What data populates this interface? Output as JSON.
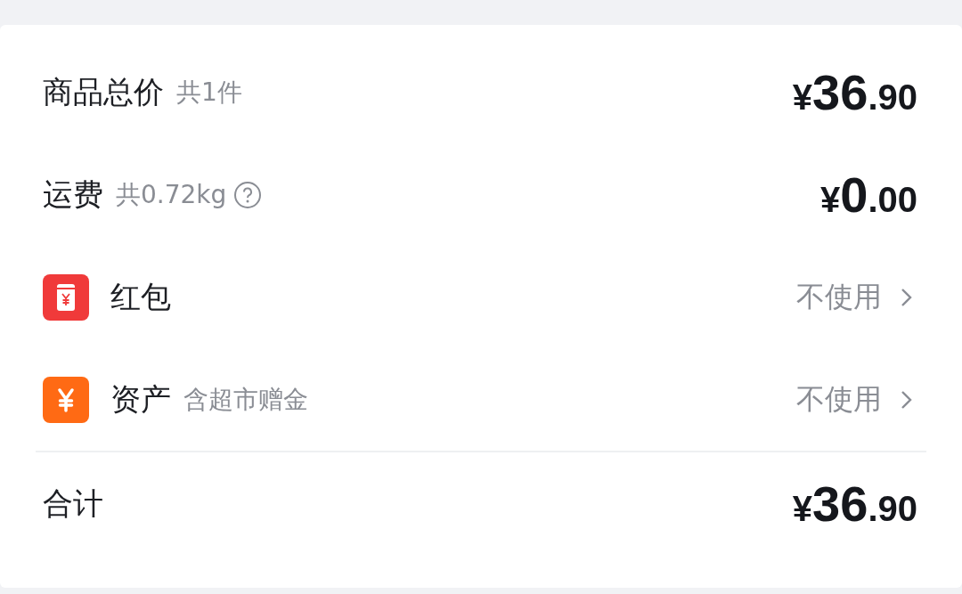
{
  "rows": [
    {
      "kind": "price",
      "label": "商品总价",
      "note": "共1件",
      "price": {
        "currency": "¥",
        "whole": "36",
        "decimal": ".90"
      }
    },
    {
      "kind": "price",
      "label": "运费",
      "note": "共0.72kg",
      "help": true,
      "price": {
        "currency": "¥",
        "whole": "0",
        "decimal": ".00"
      }
    },
    {
      "kind": "packet",
      "label": "红包",
      "value": "不使用"
    },
    {
      "kind": "asset",
      "label": "资产",
      "note": "含超市赠金",
      "value": "不使用"
    }
  ],
  "total": {
    "label": "合计",
    "price": {
      "currency": "¥",
      "whole": "36",
      "decimal": ".90"
    }
  }
}
